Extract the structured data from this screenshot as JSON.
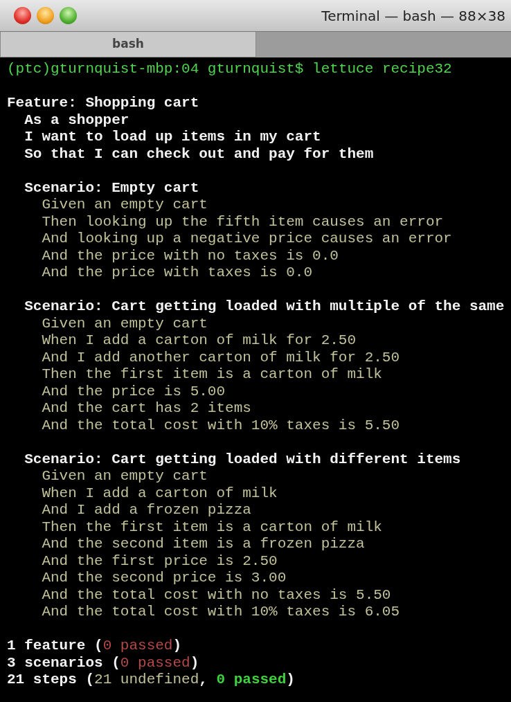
{
  "window": {
    "title": "Terminal — bash — 88×38"
  },
  "tabs": [
    {
      "label": "bash",
      "selected": true
    }
  ],
  "terminal": {
    "prompt": "(ptc)gturnquist-mbp:04 gturnquist$ lettuce recipe32",
    "feature": {
      "title": "Feature: Shopping cart",
      "description": [
        "As a shopper",
        "I want to load up items in my cart",
        "So that I can check out and pay for them"
      ],
      "scenarios": [
        {
          "title": "Scenario: Empty cart",
          "steps": [
            "Given an empty cart",
            "Then looking up the fifth item causes an error",
            "And looking up a negative price causes an error",
            "And the price with no taxes is 0.0",
            "And the price with taxes is 0.0"
          ]
        },
        {
          "title": "Scenario: Cart getting loaded with multiple of the same",
          "steps": [
            "Given an empty cart",
            "When I add a carton of milk for 2.50",
            "And I add another carton of milk for 2.50",
            "Then the first item is a carton of milk",
            "And the price is 5.00",
            "And the cart has 2 items",
            "And the total cost with 10% taxes is 5.50"
          ]
        },
        {
          "title": "Scenario: Cart getting loaded with different items",
          "steps": [
            "Given an empty cart",
            "When I add a carton of milk",
            "And I add a frozen pizza",
            "Then the first item is a carton of milk",
            "And the second item is a frozen pizza",
            "And the first price is 2.50",
            "And the second price is 3.00",
            "And the total cost with no taxes is 5.50",
            "And the total cost with 10% taxes is 6.05"
          ]
        }
      ]
    },
    "summary": [
      [
        {
          "text": "1 feature (",
          "kind": "total"
        },
        {
          "text": "0 passed",
          "kind": "failed"
        },
        {
          "text": ")",
          "kind": "total"
        }
      ],
      [
        {
          "text": "3 scenarios (",
          "kind": "total"
        },
        {
          "text": "0 passed",
          "kind": "failed"
        },
        {
          "text": ")",
          "kind": "total"
        }
      ],
      [
        {
          "text": "21 steps (",
          "kind": "total"
        },
        {
          "text": "21 undefined",
          "kind": "undefined"
        },
        {
          "text": ", ",
          "kind": "total"
        },
        {
          "text": "0 passed",
          "kind": "passed"
        },
        {
          "text": ")",
          "kind": "total"
        }
      ]
    ]
  }
}
